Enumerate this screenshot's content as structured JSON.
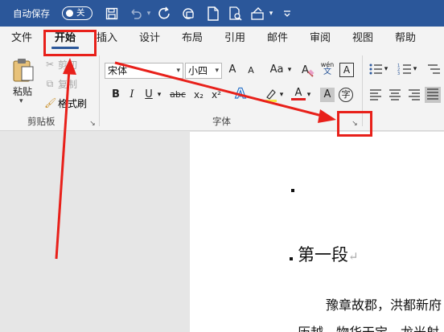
{
  "titlebar": {
    "autosave_label": "自动保存",
    "autosave_state": "关",
    "icons": [
      "save-icon",
      "undo-icon",
      "redo-icon",
      "touch-mode-icon",
      "new-document-icon",
      "print-preview-icon",
      "format-painter-qat-icon",
      "more-chevron-icon"
    ]
  },
  "tabs": [
    {
      "label": "文件"
    },
    {
      "label": "开始"
    },
    {
      "label": "插入"
    },
    {
      "label": "设计"
    },
    {
      "label": "布局"
    },
    {
      "label": "引用"
    },
    {
      "label": "邮件"
    },
    {
      "label": "审阅"
    },
    {
      "label": "视图"
    },
    {
      "label": "帮助"
    }
  ],
  "clipboard": {
    "paste": "粘贴",
    "cut": "剪切",
    "copy": "复制",
    "format_painter": "格式刷",
    "group_label": "剪贴板"
  },
  "font": {
    "font_name": "宋体",
    "font_size": "小四",
    "grow": "A",
    "shrink": "A",
    "case": "Aa",
    "phonetic_top": "wén",
    "phonetic_bottom": "文",
    "border": "A",
    "bold": "B",
    "italic": "I",
    "underline": "U",
    "strike": "abc",
    "subscript": "x₂",
    "superscript": "x²",
    "effects": "A",
    "font_color": "A",
    "char_shading": "A",
    "enclose": "字",
    "group_label": "字体"
  },
  "document": {
    "heading": "第一段",
    "line1": "豫章故郡，洪都新府",
    "line2": "历越，物华天宝，龙光射"
  },
  "colors": {
    "titlebar": "#2b579a",
    "annotation": "#e8201a"
  }
}
